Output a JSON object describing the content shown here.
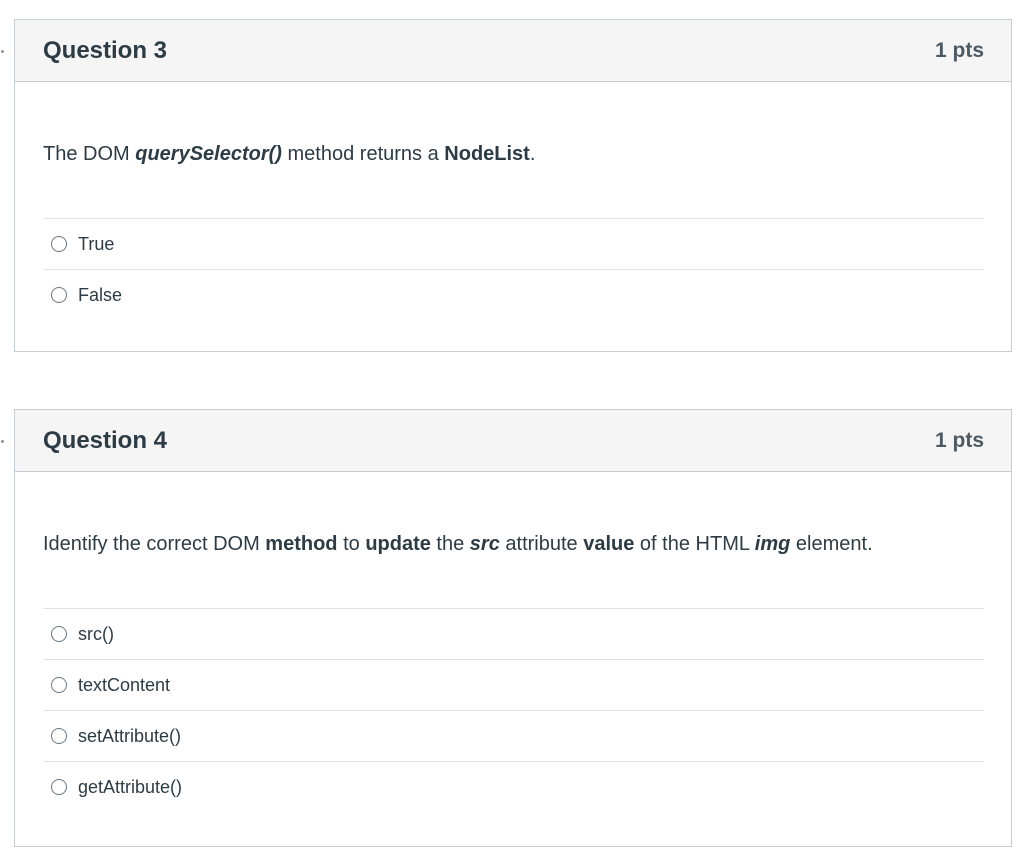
{
  "questions": [
    {
      "title": "Question 3",
      "points": "1 pts",
      "text": {
        "p1": "The DOM ",
        "p2": "querySelector()",
        "p3": " method returns a ",
        "p4": "NodeList",
        "p5": "."
      },
      "answers": [
        "True",
        "False"
      ]
    },
    {
      "title": "Question 4",
      "points": "1 pts",
      "text": {
        "p1": "Identify the correct DOM ",
        "p2": "method",
        "p3": " to ",
        "p4": "update",
        "p5": " the ",
        "p6": "src",
        "p7": " attribute ",
        "p8": "value",
        "p9": " of the HTML ",
        "p10": "img",
        "p11": " element."
      },
      "answers": [
        "src()",
        "textContent",
        "setAttribute()",
        "getAttribute()"
      ]
    }
  ]
}
